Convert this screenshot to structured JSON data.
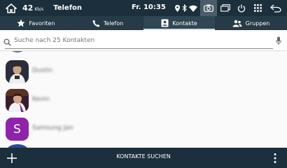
{
  "statusbar": {
    "battery": "42",
    "speed": "Kb/s",
    "title": "Telefon",
    "time": "Fr. 10:35"
  },
  "tabs": [
    {
      "label": "Favoriten",
      "icon": "star-icon",
      "active": false
    },
    {
      "label": "Telefon",
      "icon": "phone-icon",
      "active": false
    },
    {
      "label": "Kontakte",
      "icon": "contacts-icon",
      "active": true
    },
    {
      "label": "Gruppen",
      "icon": "group-icon",
      "active": false
    }
  ],
  "search": {
    "placeholder": "Suche nach 25 Kontakten"
  },
  "contacts": [
    {
      "name": "Dustin",
      "avatar_type": "photo"
    },
    {
      "name": "Kevin",
      "avatar_type": "photo"
    },
    {
      "name": "Samsung Jan",
      "avatar_type": "letter",
      "letter": "S",
      "color": "#8e24aa"
    }
  ],
  "bottombar": {
    "action_label": "KONTAKTE SUCHEN"
  },
  "colors": {
    "statusbar_bg": "#1c2f3c",
    "tabbar_bg": "#263a47",
    "active_tab_bg": "#2f4654"
  }
}
